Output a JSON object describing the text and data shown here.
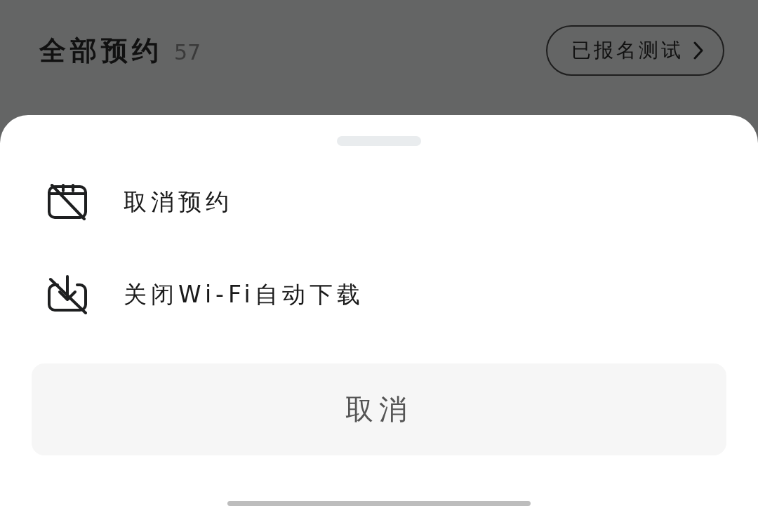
{
  "header": {
    "title": "全部预约",
    "count": "57",
    "action": "已报名测试"
  },
  "sheet": {
    "items": [
      {
        "label": "取消预约"
      },
      {
        "label": "关闭Wi-Fi自动下载"
      }
    ],
    "cancel": "取消"
  }
}
